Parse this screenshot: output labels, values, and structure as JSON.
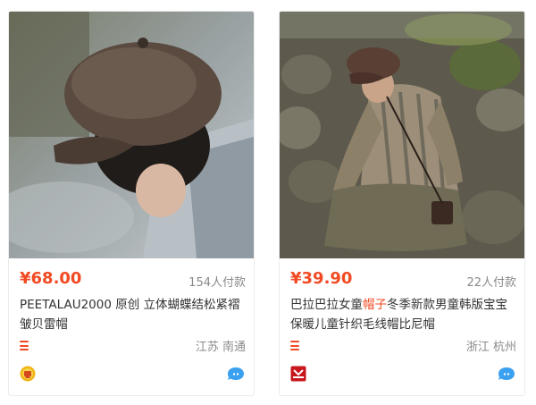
{
  "products": [
    {
      "price": "¥68.00",
      "sold": "154人付款",
      "title_before": "PEETALAU2000 原创 立体蝴蝶结松紧褶皱贝雷帽",
      "title_highlight": "",
      "title_after": "",
      "location": "江苏 南通",
      "image_icon": "photo-man-newsboy-cap-icon",
      "shop_icon": "gold-shop-badge-icon"
    },
    {
      "price": "¥39.90",
      "sold": "22人付款",
      "title_before": "巴拉巴拉女童",
      "title_highlight": "帽子",
      "title_after": "冬季新款男童韩版宝宝保暖儿童针织毛线帽比尼帽",
      "location": "浙江 杭州",
      "image_icon": "photo-man-on-stone-wall-icon",
      "shop_icon": "red-shop-logo-icon"
    }
  ],
  "colors": {
    "price": "#f14a23",
    "muted": "#8a8a8a",
    "text": "#333333",
    "bubble": "#3aa0f0"
  }
}
